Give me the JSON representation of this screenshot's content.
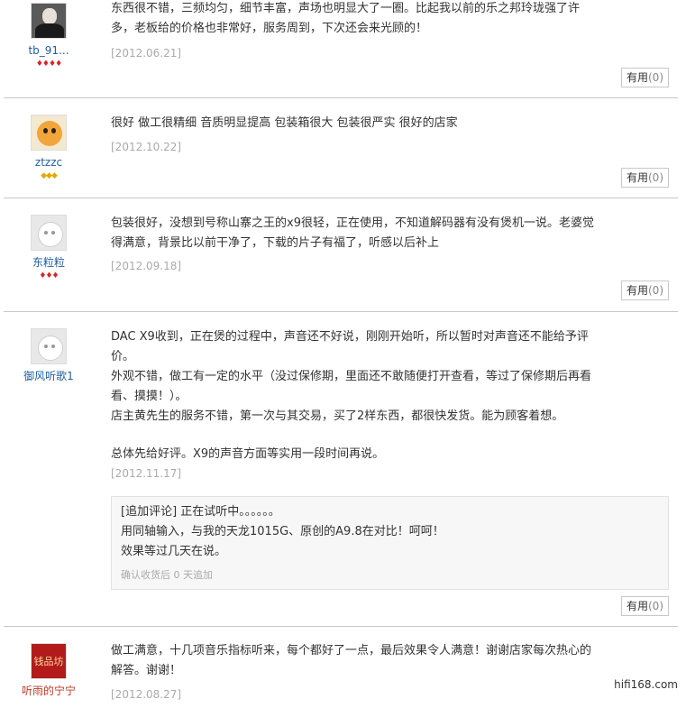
{
  "reviews": [
    {
      "username": "tb_91...",
      "rank": "♦♦♦♦",
      "lines": [
        "东西很不错，三频均匀，细节丰富，声场也明显大了一圈。比起我以前的乐之邦玲珑强了许",
        "多，老板给的价格也非常好，服务周到，下次还会来光顾的！"
      ],
      "date": "[2012.06.21]",
      "helpful_label": "有用",
      "helpful_count": "(0)"
    },
    {
      "username": "ztzzc",
      "rank": "◆◆◆",
      "lines": [
        "很好 做工很精细 音质明显提高 包装箱很大 包装很严实 很好的店家"
      ],
      "date": "[2012.10.22]",
      "helpful_label": "有用",
      "helpful_count": "(0)"
    },
    {
      "username": "东粒粒",
      "rank": "♦♦♦",
      "lines": [
        "包装很好，没想到号称山寨之王的x9很轻，正在使用，不知道解码器有没有煲机一说。老婆觉",
        "得满意，背景比以前干净了，下载的片子有福了，听感以后补上"
      ],
      "date": "[2012.09.18]",
      "helpful_label": "有用",
      "helpful_count": "(0)"
    },
    {
      "username": "御风听歌1",
      "lines": [
        "DAC X9收到，正在煲的过程中，声音还不好说，刚刚开始听，所以暂时对声音还不能给予评",
        "价。",
        "外观不错，做工有一定的水平（没过保修期，里面还不敢随便打开查看，等过了保修期后再看",
        "看、摸摸！）。",
        "店主黄先生的服务不错，第一次与其交易，买了2样东西，都很快发货。能为顾客着想。",
        "",
        "总体先给好评。X9的声音方面等实用一段时间再说。"
      ],
      "date": "[2012.11.17]",
      "append_lines": [
        "[追加评论] 正在试听中。。。。。。",
        "用同轴输入，与我的天龙1015G、原创的A9.8在对比！呵呵！",
        "效果等过几天在说。"
      ],
      "append_meta": "确认收货后 0 天追加",
      "helpful_label": "有用",
      "helpful_count": "(0)"
    },
    {
      "username": "听雨的宁宁",
      "avatar_text": "钱品坊",
      "lines": [
        "做工满意，十几项音乐指标听来，每个都好了一点，最后效果令人满意！谢谢店家每次热心的",
        "解答。谢谢！"
      ],
      "date": "[2012.08.27]"
    }
  ],
  "watermark": "hifi168.com"
}
